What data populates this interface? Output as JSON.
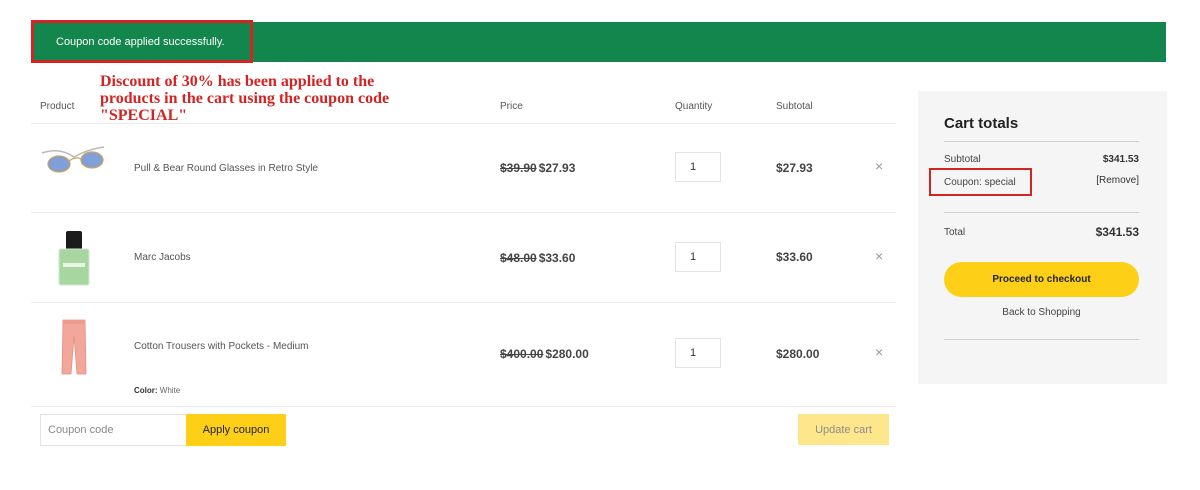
{
  "notice": {
    "message": "Coupon code applied successfully."
  },
  "annotation": {
    "text": "Discount of 30% has been applied to the\nproducts in the cart using the coupon code\n\"SPECIAL\""
  },
  "table": {
    "headers": {
      "product": "Product",
      "price": "Price",
      "quantity": "Quantity",
      "subtotal": "Subtotal"
    },
    "rows": [
      {
        "name": "Pull & Bear Round Glasses in Retro Style",
        "old_price": "$39.90",
        "price": "$27.93",
        "qty": "1",
        "subtotal": "$27.93",
        "remove": "×"
      },
      {
        "name": "Marc Jacobs",
        "old_price": "$48.00",
        "price": "$33.60",
        "qty": "1",
        "subtotal": "$33.60",
        "remove": "×"
      },
      {
        "name": "Cotton Trousers with Pockets - Medium",
        "old_price": "$400.00",
        "price": "$280.00",
        "qty": "1",
        "subtotal": "$280.00",
        "remove": "×",
        "meta_label": "Color:",
        "meta_value": "White"
      }
    ]
  },
  "coupon": {
    "placeholder": "Coupon code",
    "apply_label": "Apply coupon"
  },
  "update_label": "Update cart",
  "totals": {
    "title": "Cart totals",
    "subtotal_label": "Subtotal",
    "subtotal_value": "$341.53",
    "coupon_label": "Coupon: special",
    "coupon_remove": "[Remove]",
    "total_label": "Total",
    "total_value": "$341.53",
    "checkout_label": "Proceed to checkout",
    "back_label": "Back to Shopping"
  },
  "colors": {
    "notice_bg": "#12864c",
    "accent": "#fdd017",
    "annotation": "#d32424"
  }
}
